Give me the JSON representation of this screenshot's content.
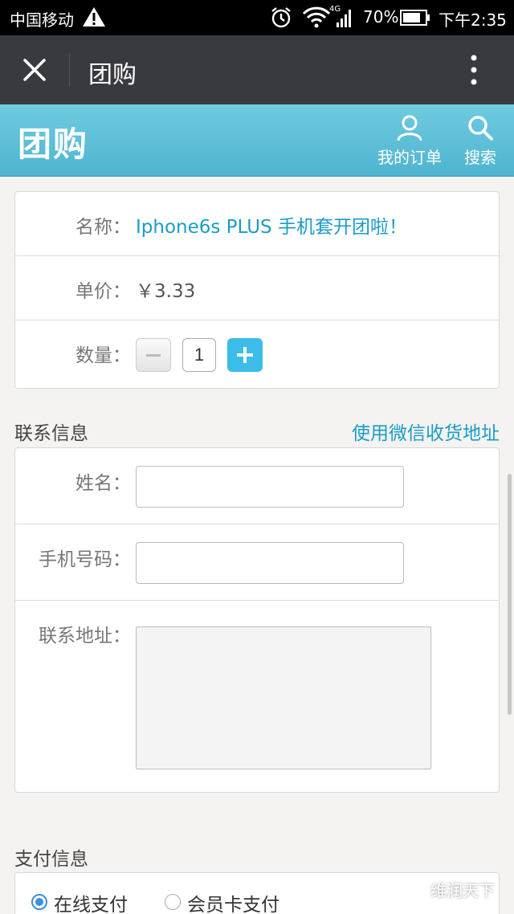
{
  "status_bar": {
    "carrier": "中国移动",
    "network_label": "4G",
    "battery_percent": "70%",
    "time": "下午2:35",
    "icons": [
      "warning-icon",
      "alarm-icon",
      "wifi-icon",
      "signal-icon",
      "battery-icon"
    ]
  },
  "title_bar": {
    "title": "团购",
    "icons": [
      "close-icon",
      "more-icon"
    ]
  },
  "header": {
    "brand": "团购",
    "my_orders_label": "我的订单",
    "search_label": "搜索",
    "color": "#5bbfd8"
  },
  "product": {
    "name_label": "名称：",
    "name_value": "Iphone6s PLUS 手机套开团啦！",
    "price_label": "单价：",
    "price_value": "￥3.33",
    "quantity_label": "数量：",
    "quantity_value": "1"
  },
  "contact": {
    "section_title": "联系信息",
    "wechat_address_link": "使用微信收货地址",
    "name_label": "姓名：",
    "phone_label": "手机号码：",
    "address_label": "联系地址："
  },
  "payment": {
    "section_title": "支付信息",
    "options": [
      {
        "label": "在线支付",
        "selected": true
      },
      {
        "label": "会员卡支付",
        "selected": false
      }
    ]
  },
  "watermark": {
    "text": "维润天下"
  },
  "colors": {
    "accent": "#1a9cc5",
    "plus_button": "#3cbce8",
    "radio": "#3a8fe0",
    "title_bar": "#393a3f"
  }
}
